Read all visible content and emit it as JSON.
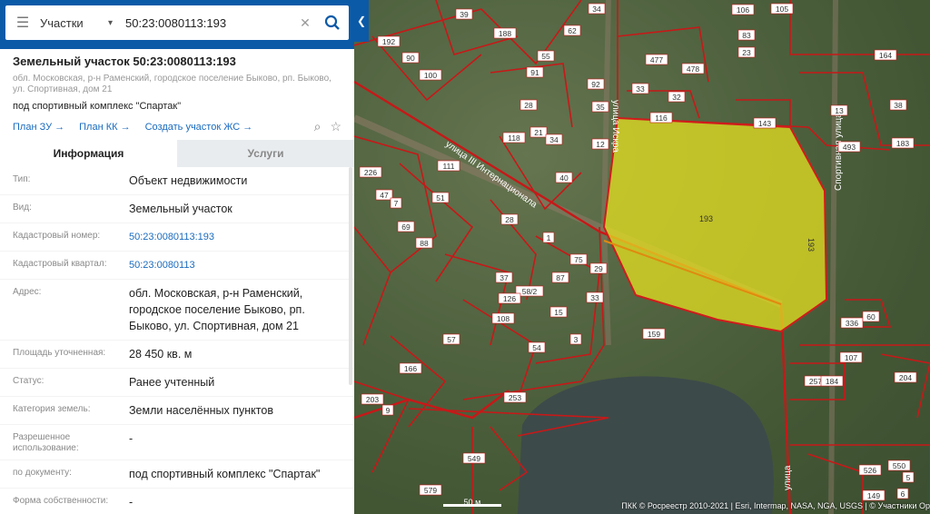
{
  "search": {
    "layer": "Участки",
    "query": "50:23:0080113:193"
  },
  "object": {
    "title": "Земельный участок 50:23:0080113:193",
    "address": "обл. Московская, р-н Раменский, городское поселение Быково, рп. Быково, ул. Спортивная, дом 21",
    "purpose": "под спортивный комплекс \"Спартак\"",
    "links": [
      "План ЗУ →",
      "План КК →",
      "Создать участок ЖС →"
    ]
  },
  "tabs": [
    "Информация",
    "Услуги"
  ],
  "info": {
    "rows": [
      {
        "label": "Тип:",
        "value": "Объект недвижимости"
      },
      {
        "label": "Вид:",
        "value": "Земельный участок"
      },
      {
        "label": "Кадастровый номер:",
        "value": "50:23:0080113:193"
      },
      {
        "label": "Кадастровый квартал:",
        "value": "50:23:0080113"
      },
      {
        "label": "Адрес:",
        "value": "обл. Московская, р-н Раменский, городское поселение Быково, рп. Быково, ул. Спортивная, дом 21"
      },
      {
        "label": "Площадь уточненная:",
        "value": "28 450 кв. м"
      },
      {
        "label": "Статус:",
        "value": "Ранее учтенный"
      },
      {
        "label": "Категория земель:",
        "value": "Земли населённых пунктов"
      },
      {
        "label": "Разрешенное использование:",
        "value": "-"
      },
      {
        "label": "по документу:",
        "value": "под спортивный комплекс \"Спартак\""
      },
      {
        "label": "Форма собственности:",
        "value": "-"
      }
    ]
  },
  "map": {
    "parcel_label": "193",
    "side_label": "193",
    "street_labels": [
      "улица III Интернационала",
      "улица Искра",
      "Спортивная улица",
      "улица"
    ],
    "scale": "50 м",
    "attribution": "ПКК © Росреестр 2010-2021 | Esri, Intermap, NASA, NGA, USGS | © Участники Op",
    "parcel_numbers": [
      "39",
      "188",
      "62",
      "34",
      "106",
      "105",
      "192",
      "90",
      "55",
      "83",
      "91",
      "477",
      "478",
      "23",
      "164",
      "100",
      "92",
      "33",
      "32",
      "116",
      "143",
      "38",
      "13",
      "28",
      "35",
      "118",
      "21",
      "34",
      "12",
      "493",
      "183",
      "111",
      "40",
      "226",
      "47",
      "7",
      "51",
      "28",
      "1",
      "69",
      "88",
      "75",
      "87",
      "29",
      "37",
      "58/2",
      "15",
      "33",
      "336",
      "60",
      "126",
      "108",
      "57",
      "54",
      "3",
      "159",
      "107",
      "166",
      "253",
      "257",
      "184",
      "204",
      "203",
      "9",
      "549",
      "526",
      "550",
      "5",
      "579",
      "6",
      "149"
    ],
    "colors": {
      "parcel_fill": "#e6e020",
      "parcel_border": "#d01c1c",
      "boundary": "#c81818"
    }
  },
  "icons": {
    "menu": "menu-icon",
    "chevron": "chevron-down-icon",
    "clear": "close-icon",
    "search": "search-icon",
    "collapse": "chevron-left-icon",
    "locate": "locate-icon",
    "favorite": "star-icon"
  }
}
